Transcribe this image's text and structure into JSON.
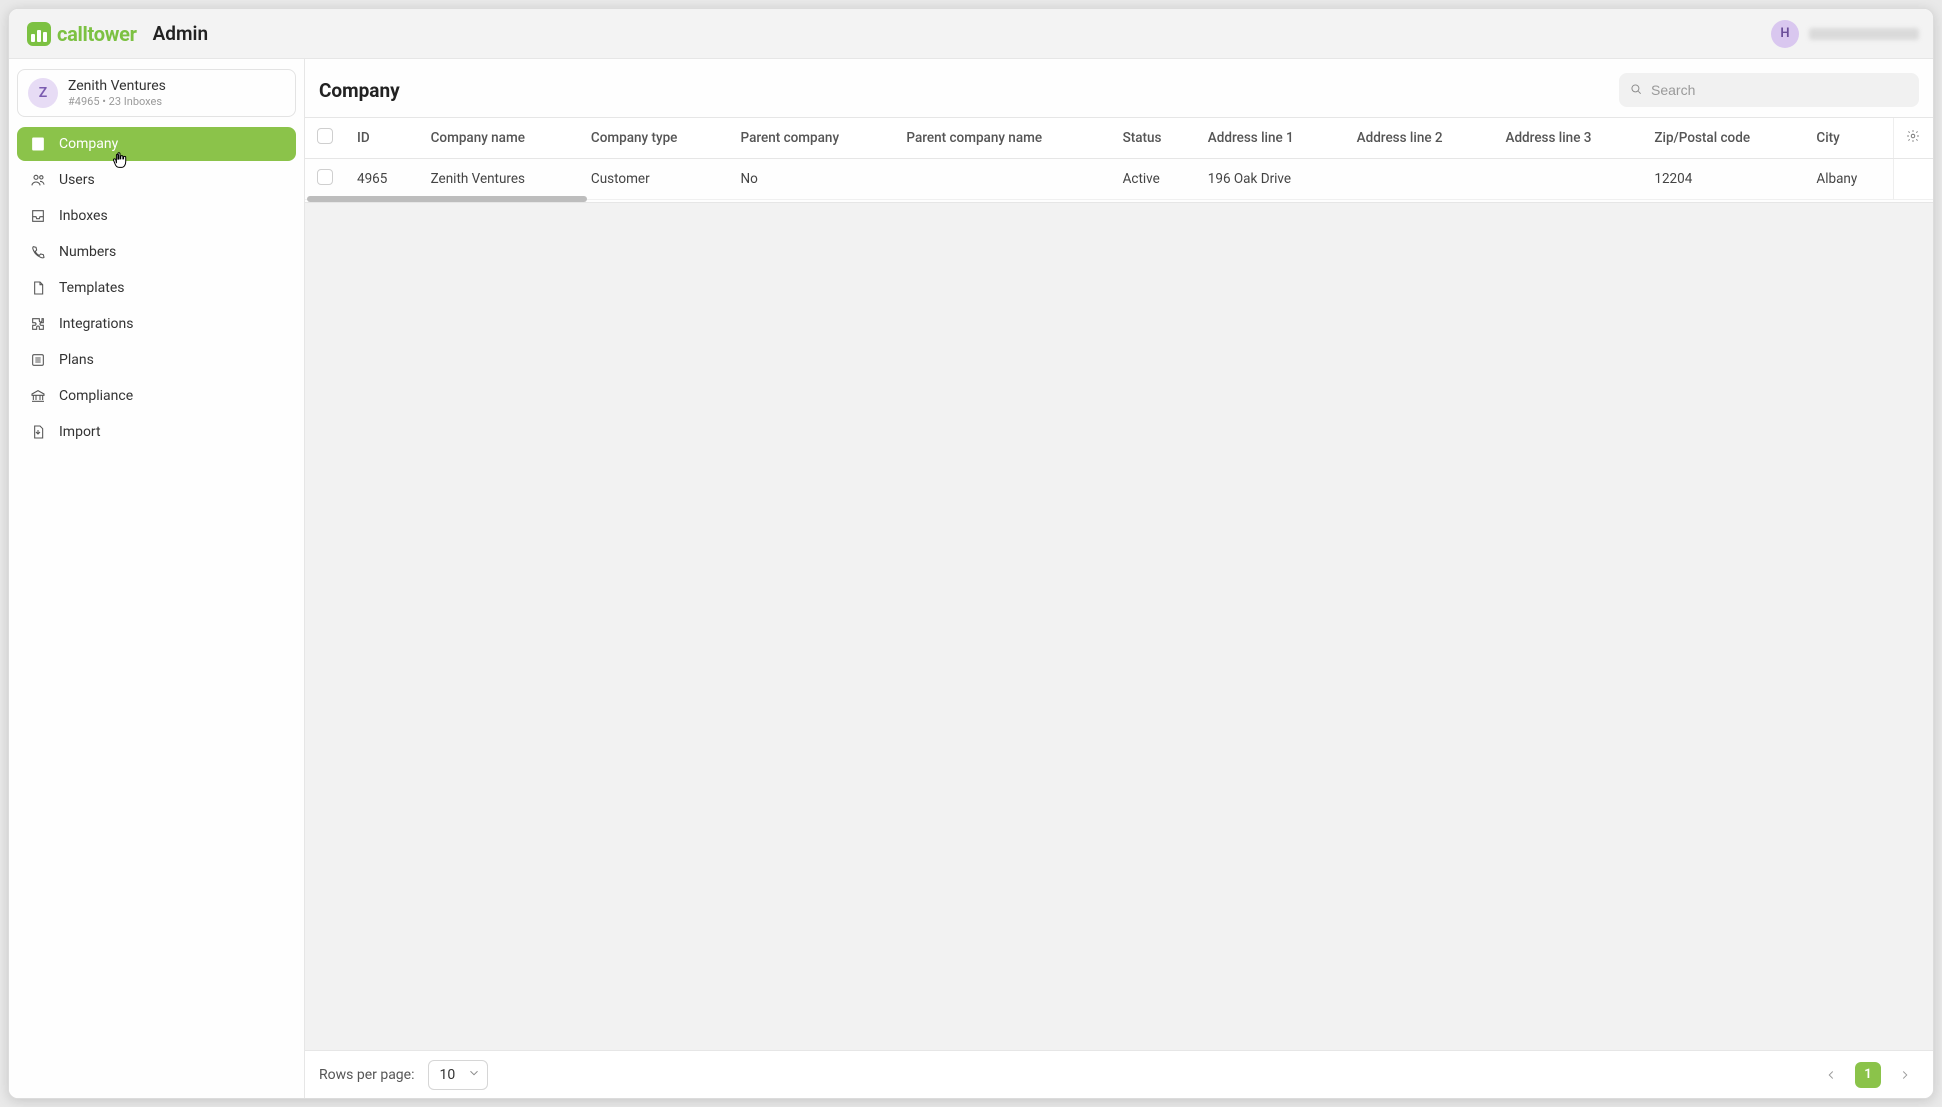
{
  "header": {
    "brand": "calltower",
    "title": "Admin",
    "user_initial": "H"
  },
  "sidebar": {
    "company_card": {
      "initial": "Z",
      "name": "Zenith Ventures",
      "subline": "#4965 • 23 Inboxes"
    },
    "items": [
      {
        "icon": "building-icon",
        "label": "Company",
        "active": true
      },
      {
        "icon": "users-icon",
        "label": "Users",
        "active": false
      },
      {
        "icon": "inbox-icon",
        "label": "Inboxes",
        "active": false
      },
      {
        "icon": "phone-icon",
        "label": "Numbers",
        "active": false
      },
      {
        "icon": "file-icon",
        "label": "Templates",
        "active": false
      },
      {
        "icon": "puzzle-icon",
        "label": "Integrations",
        "active": false
      },
      {
        "icon": "list-icon",
        "label": "Plans",
        "active": false
      },
      {
        "icon": "bank-icon",
        "label": "Compliance",
        "active": false
      },
      {
        "icon": "import-icon",
        "label": "Import",
        "active": false
      }
    ]
  },
  "main": {
    "title": "Company",
    "search_placeholder": "Search"
  },
  "table": {
    "columns": [
      "ID",
      "Company name",
      "Company type",
      "Parent company",
      "Parent company name",
      "Status",
      "Address line 1",
      "Address line 2",
      "Address line 3",
      "Zip/Postal code",
      "City"
    ],
    "rows": [
      {
        "id": "4965",
        "company_name": "Zenith Ventures",
        "company_type": "Customer",
        "parent_company": "No",
        "parent_company_name": "",
        "status": "Active",
        "address1": "196 Oak Drive",
        "address2": "",
        "address3": "",
        "zip": "12204",
        "city": "Albany"
      }
    ]
  },
  "footer": {
    "rows_label": "Rows per page:",
    "rows_value": "10",
    "current_page": "1"
  }
}
